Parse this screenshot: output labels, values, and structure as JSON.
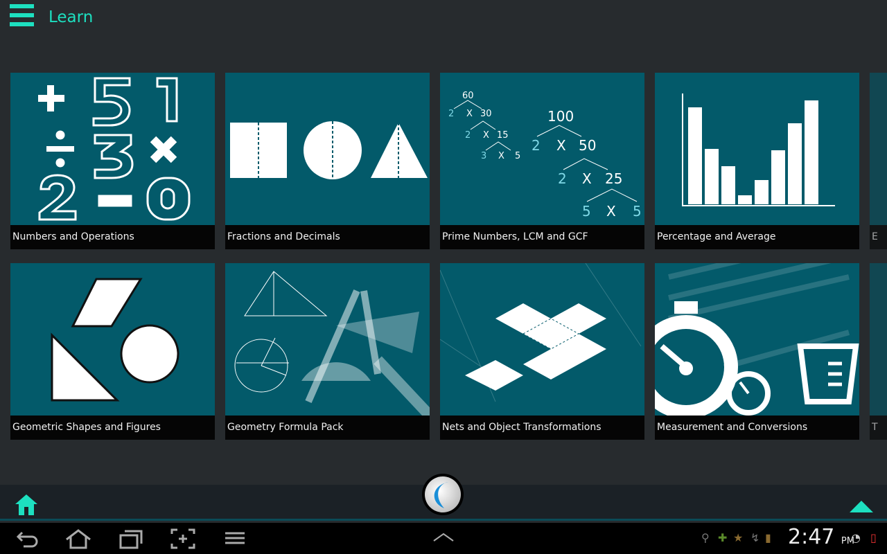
{
  "header": {
    "title": "Learn",
    "menu_icon": "hamburger-menu-icon"
  },
  "tiles": [
    {
      "label": "Numbers and Operations"
    },
    {
      "label": "Fractions and Decimals"
    },
    {
      "label": "Prime Numbers, LCM and GCF",
      "tree": [
        "60",
        "2",
        "X",
        "30",
        "2",
        "X",
        "15",
        "3",
        "X",
        "5",
        "100",
        "2",
        "X",
        "50",
        "2",
        "X",
        "25",
        "5",
        "X",
        "5"
      ]
    },
    {
      "label": "Percentage and Average"
    },
    {
      "label": "Geometric Shapes and Figures"
    },
    {
      "label": "Geometry Formula Pack"
    },
    {
      "label": "Nets and Object Transformations"
    },
    {
      "label": "Measurement and Conversions"
    }
  ],
  "partial_tiles": [
    {
      "label": "E"
    },
    {
      "label": "T"
    }
  ],
  "appbar": {
    "home_icon": "home-icon",
    "logo": "app-logo",
    "scroll_up_icon": "triangle-up-icon"
  },
  "statusbar": {
    "time": "2:47",
    "ampm": "PM"
  },
  "colors": {
    "accent": "#1de0c0",
    "tile": "#035a6a",
    "background": "#272b2e"
  }
}
